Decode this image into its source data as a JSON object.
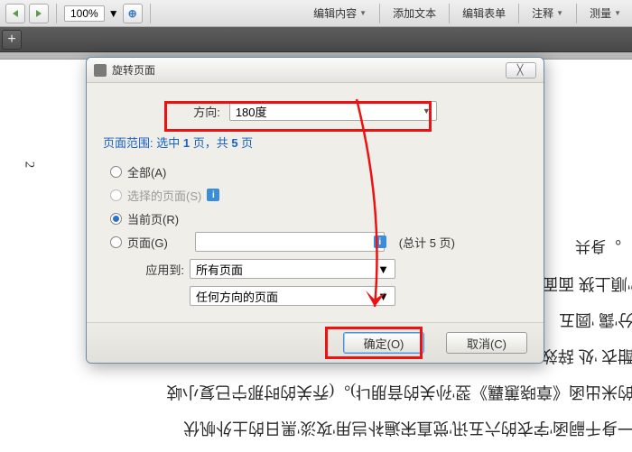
{
  "toolbar": {
    "zoom": "100%",
    "items": [
      "编辑内容",
      "添加文本",
      "编辑表单",
      "注释",
      "测量"
    ]
  },
  "dialog": {
    "title": "旋转页面",
    "direction_label": "方向:",
    "direction_value": "180度",
    "range_prefix": "页面范围: 选中 ",
    "range_sel": "1",
    "range_mid": " 页，共 ",
    "range_total": "5",
    "range_suffix": " 页",
    "opt_all": "全部(A)",
    "opt_selected": "选择的页面(S)",
    "opt_current": "当前页(R)",
    "opt_pages": "页面(G)",
    "total_label": "(总计 5 页)",
    "apply_label": "应用到:",
    "apply_value": "所有页面",
    "orient_value": "任何方向的页面",
    "ok": "确定(O)",
    "cancel": "取消(C)"
  },
  "doc": {
    "page_num": "2",
    "l1": "。身共",
    "l2": "\"順上狭            面面的",
    "l3": "分'靄            '圆五",
    "l4": "酣衣 '处            辞效目",
    "l5": "的米出函《章晓蕙覊》翌'孙关的音朋냐)。(乔关的时那宁已复小岐",
    "l6": "一身千嗣函'字衣的六五讯'觉直宋遍补岂用'攻淡'黑日的土外帆伏"
  }
}
